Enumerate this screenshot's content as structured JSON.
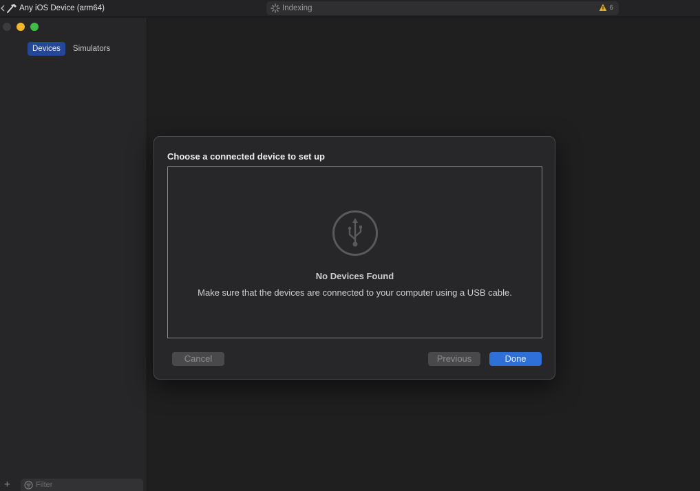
{
  "toolbar": {
    "scheme_label": "Any iOS Device (arm64)",
    "status_text": "Indexing",
    "warning_count": "6"
  },
  "sidebar": {
    "tabs": [
      {
        "label": "Devices",
        "active": true
      },
      {
        "label": "Simulators",
        "active": false
      }
    ],
    "filter_placeholder": "Filter"
  },
  "dialog": {
    "title": "Choose a connected device to set up",
    "empty_title": "No Devices Found",
    "empty_message": "Make sure that the devices are connected to your computer using a USB cable.",
    "buttons": {
      "cancel": "Cancel",
      "previous": "Previous",
      "done": "Done"
    }
  },
  "colors": {
    "accent": "#2e6fd8",
    "tab_active": "#23489a",
    "traffic_close": "#3c3c3e",
    "traffic_minimize": "#f2b62d",
    "traffic_maximize": "#3fbe47",
    "warning": "#e3b32e"
  },
  "icons": {
    "scheme": "hammer-icon",
    "status": "spinner-icon",
    "warning": "warning-triangle-icon",
    "empty_state": "usb-icon",
    "add": "plus-icon",
    "filter": "filter-icon"
  }
}
